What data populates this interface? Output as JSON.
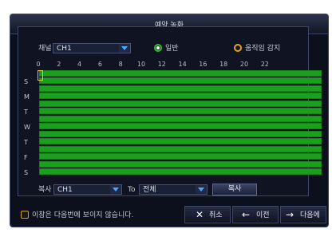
{
  "dialog": {
    "title": "예약 녹화"
  },
  "channel": {
    "label": "채널",
    "value": "CH1"
  },
  "modes": [
    {
      "label": "일반",
      "color": "#2fbf2f",
      "selected": true
    },
    {
      "label": "움직임 감지",
      "color": "#e6a21c",
      "selected": false
    }
  ],
  "schedule": {
    "hour_labels": [
      "0",
      "2",
      "4",
      "6",
      "8",
      "10",
      "12",
      "14",
      "16",
      "18",
      "20",
      "22"
    ],
    "days": [
      "S",
      "M",
      "T",
      "W",
      "T",
      "F",
      "S"
    ]
  },
  "copy": {
    "label": "복사",
    "from_value": "CH1",
    "to_label": "To",
    "to_value": "전체",
    "button_label": "복사"
  },
  "footer": {
    "dont_show_label": "이창은 다음번에 보이지 않습니다.",
    "cancel_label": "취소",
    "prev_label": "이전",
    "next_label": "다음에"
  },
  "colors": {
    "record_green": "#1aa01c",
    "accent_gold": "#e8c434"
  }
}
